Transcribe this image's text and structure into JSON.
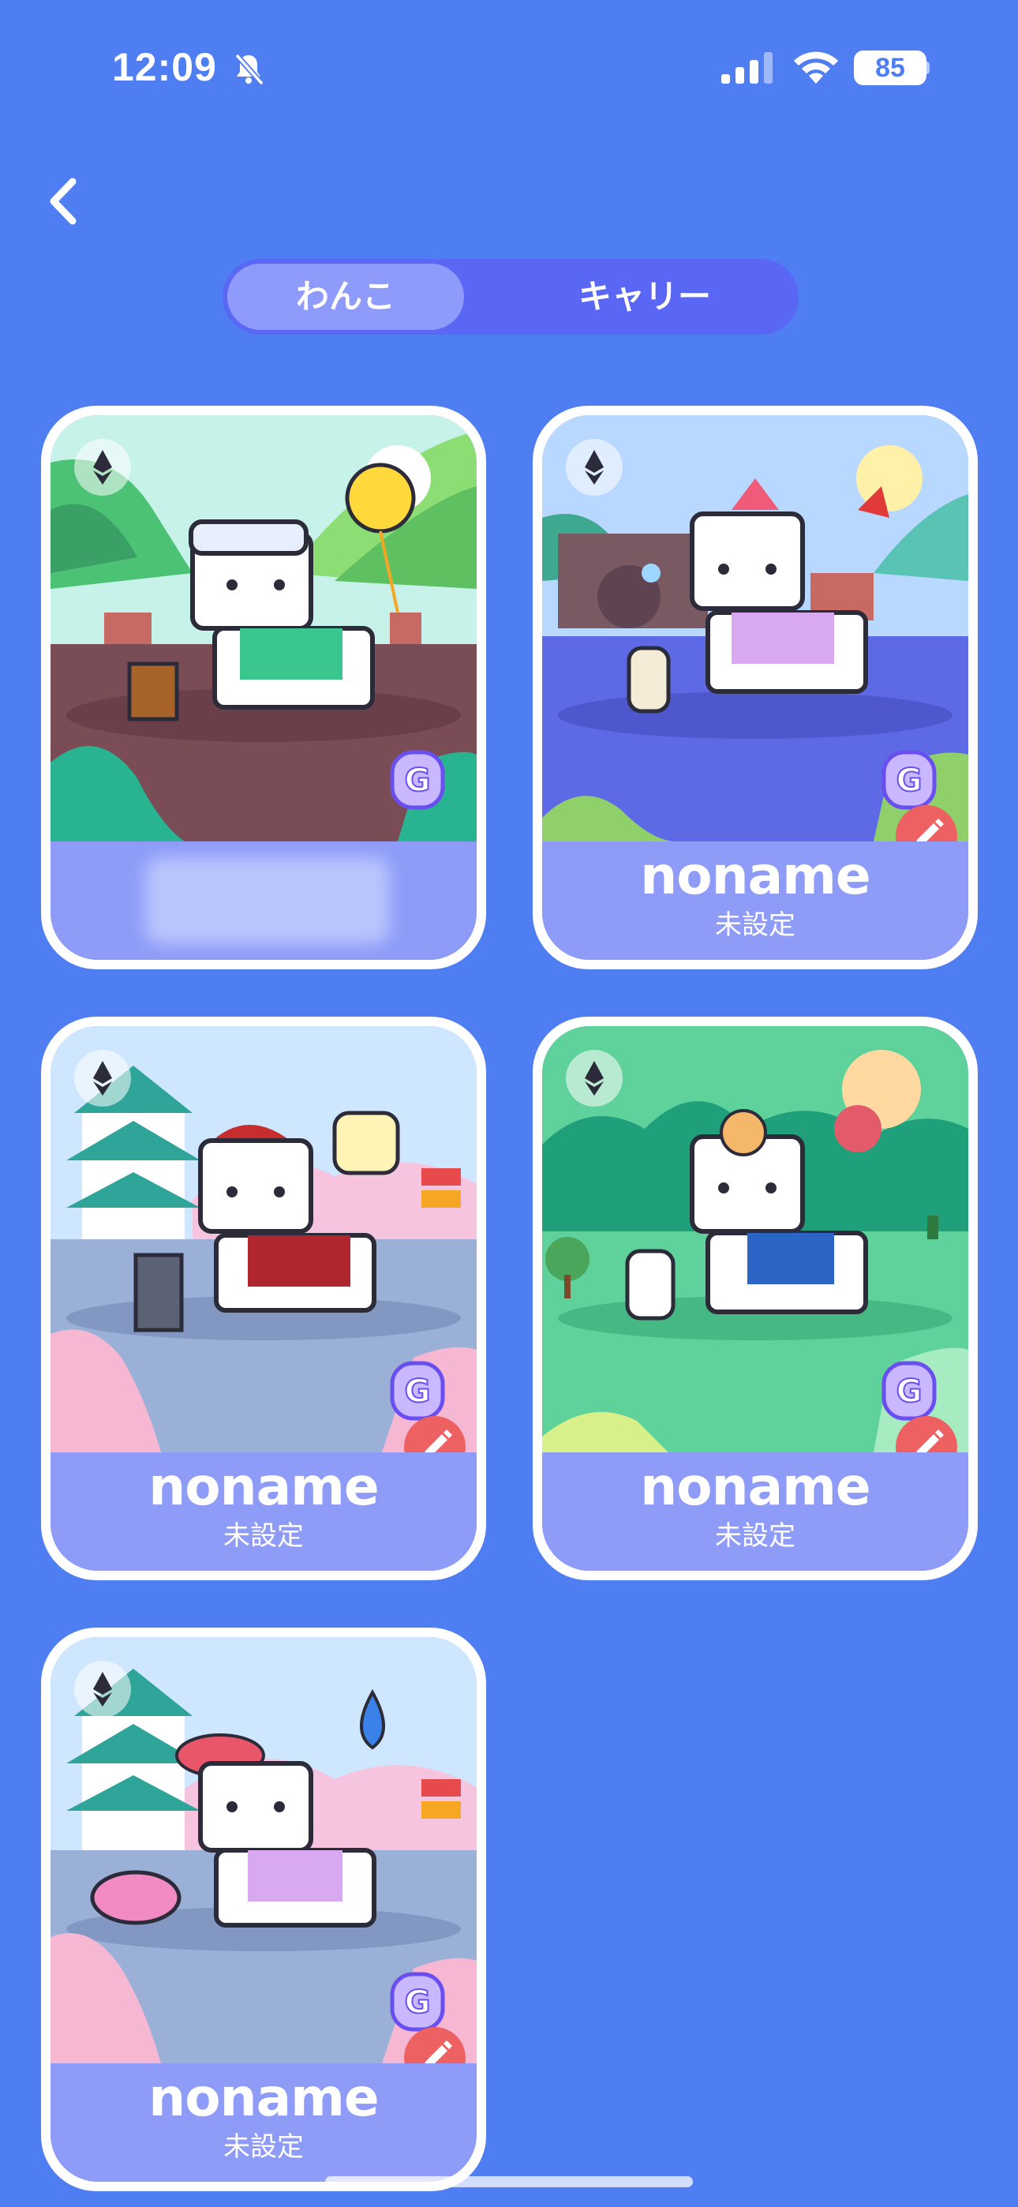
{
  "status_bar": {
    "time": "12:09",
    "battery": "85",
    "icons": [
      "bell-slash-icon",
      "cellular-signal-icon",
      "wifi-icon",
      "battery-icon"
    ]
  },
  "nav": {
    "back_icon": "chevron-left-icon"
  },
  "segment": {
    "tabs": [
      {
        "label": "わんこ",
        "active": true
      },
      {
        "label": "キャリー",
        "active": false
      }
    ]
  },
  "cards": [
    {
      "name": "",
      "subtitle": "",
      "name_hidden": true,
      "scene": "forest-hills",
      "editable": false
    },
    {
      "name": "noname",
      "subtitle": "未設定",
      "scene": "mission-lake",
      "editable": true
    },
    {
      "name": "noname",
      "subtitle": "未設定",
      "scene": "castle-sakura",
      "editable": true
    },
    {
      "name": "noname",
      "subtitle": "未設定",
      "scene": "green-park",
      "editable": true
    },
    {
      "name": "noname",
      "subtitle": "未設定",
      "scene": "castle-sakura",
      "editable": true
    }
  ],
  "colors": {
    "background": "#4f7ef2",
    "segment_track": "#5a67f5",
    "segment_active": "#8f9bfb",
    "card_footer": "#8e9cf8",
    "edit_button": "#ee6162"
  }
}
